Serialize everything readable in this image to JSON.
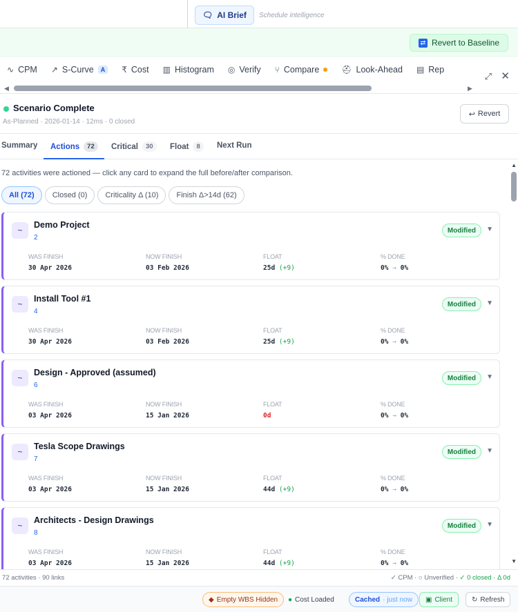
{
  "topbar": {
    "ai_brief_label": "AI Brief",
    "subtitle": "Schedule intelligence"
  },
  "revert_baseline_label": "Revert to Baseline",
  "tabs": [
    {
      "label": "CPM",
      "icon": "pulse-icon"
    },
    {
      "label": "S-Curve",
      "icon": "trend-icon",
      "badge": "A"
    },
    {
      "label": "Cost",
      "icon": "rupee-icon"
    },
    {
      "label": "Histogram",
      "icon": "bar-chart-icon"
    },
    {
      "label": "Verify",
      "icon": "check-circle-icon"
    },
    {
      "label": "Compare",
      "icon": "branch-icon",
      "dot": true
    },
    {
      "label": "Look-Ahead",
      "icon": "hardhat-icon"
    },
    {
      "label": "Rep",
      "icon": "document-icon"
    }
  ],
  "scenario": {
    "title": "Scenario Complete",
    "meta": "As-Planned · 2026-01-14 · 12ms · 0 closed",
    "revert_label": "Revert"
  },
  "subtabs": [
    {
      "label": "Summary"
    },
    {
      "label": "Actions",
      "count": "72",
      "active": true
    },
    {
      "label": "Critical",
      "count": "30"
    },
    {
      "label": "Float",
      "count": "8"
    },
    {
      "label": "Next Run"
    }
  ],
  "hint": "72 activities were actioned — click any card to expand the full before/after comparison.",
  "filters": [
    "All (72)",
    "Closed (0)",
    "Criticality Δ (10)",
    "Finish Δ>14d (62)"
  ],
  "column_labels": {
    "was": "WAS FINISH",
    "now": "NOW FINISH",
    "float": "FLOAT",
    "done": "% DONE"
  },
  "status_label": "Modified",
  "cards": [
    {
      "name": "Demo Project",
      "id": "2",
      "was": "30 Apr 2026",
      "now": "03 Feb 2026",
      "float": "25d",
      "float_delta": "(+9)",
      "done_from": "0%",
      "done_to": "0%"
    },
    {
      "name": "Install Tool #1",
      "id": "4",
      "was": "30 Apr 2026",
      "now": "03 Feb 2026",
      "float": "25d",
      "float_delta": "(+9)",
      "done_from": "0%",
      "done_to": "0%"
    },
    {
      "name": "Design - Approved (assumed)",
      "id": "6",
      "was": "03 Apr 2026",
      "now": "15 Jan 2026",
      "float": "0d",
      "float_delta": "",
      "done_from": "0%",
      "done_to": "0%"
    },
    {
      "name": "Tesla Scope Drawings",
      "id": "7",
      "was": "03 Apr 2026",
      "now": "15 Jan 2026",
      "float": "44d",
      "float_delta": "(+9)",
      "done_from": "0%",
      "done_to": "0%"
    },
    {
      "name": "Architects - Design Drawings",
      "id": "8",
      "was": "03 Apr 2026",
      "now": "15 Jan 2026",
      "float": "44d",
      "float_delta": "(+9)",
      "done_from": "0%",
      "done_to": "0%"
    }
  ],
  "statusbar": {
    "left": "72 activities · 90 links",
    "right_main": "✓ CPM · ○ Unverified",
    "right_green": "· ✓ 0 closed · Δ 0d"
  },
  "bottombar": {
    "wbs": "Empty WBS Hidden",
    "cost": "Cost Loaded",
    "cached": "Cached",
    "cached_sub": "· just now",
    "client": "Client",
    "refresh": "Refresh"
  }
}
